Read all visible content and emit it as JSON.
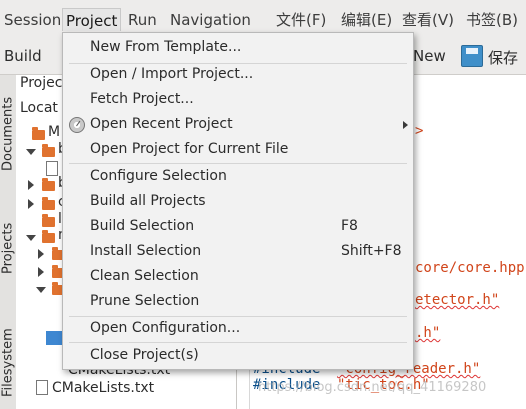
{
  "menubar": {
    "items": [
      "Session",
      "Project",
      "Run",
      "Navigation",
      "文件(F)",
      "编辑(E)",
      "查看(V)",
      "书签(B)"
    ]
  },
  "toolbar": {
    "build_label": "Build",
    "new_label": "New",
    "save_label": "保存"
  },
  "vertical_tabs": [
    "Documents",
    "Projects",
    "Filesystem"
  ],
  "project_panel": {
    "header": "Projec",
    "locate_label": "Locat",
    "tree_labels": [
      "M",
      "b",
      "b",
      "c",
      "l",
      "n",
      "CMakeLists.txt",
      "CMakeLists.txt"
    ]
  },
  "editor": {
    "lines": [
      {
        "text": ">"
      },
      {
        "text": "core/core.hpp"
      },
      {
        "text": "etector.h\""
      },
      {
        "text": ".h\""
      },
      {
        "kw": "#include",
        "str": "\"config_reader.h\""
      },
      {
        "kw": "#include",
        "str": "\"tic_toc.h\""
      }
    ]
  },
  "project_menu": {
    "items": [
      {
        "label": "New From Template...",
        "shortcut": ""
      },
      {
        "label": "Open / Import Project...",
        "shortcut": ""
      },
      {
        "label": "Fetch Project...",
        "shortcut": ""
      },
      {
        "label": "Open Recent Project",
        "shortcut": "",
        "submenu": true,
        "icon": "recent-icon"
      },
      {
        "label": "Open Project for Current File",
        "shortcut": ""
      },
      {
        "label": "Configure Selection",
        "shortcut": ""
      },
      {
        "label": "Build all Projects",
        "shortcut": ""
      },
      {
        "label": "Build Selection",
        "shortcut": "F8"
      },
      {
        "label": "Install Selection",
        "shortcut": "Shift+F8"
      },
      {
        "label": "Clean Selection",
        "shortcut": ""
      },
      {
        "label": "Prune Selection",
        "shortcut": ""
      },
      {
        "label": "Open Configuration...",
        "shortcut": ""
      },
      {
        "label": "Close Project(s)",
        "shortcut": ""
      }
    ]
  },
  "watermark": "https://blog.csdn.net/qq_41169280",
  "colors": {
    "accent": "#3e87d1",
    "folder": "#e0722f",
    "string": "#d1451b",
    "keyword": "#0b4f8a"
  }
}
